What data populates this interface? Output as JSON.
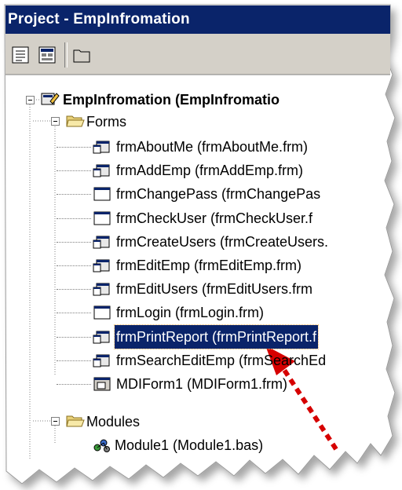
{
  "window": {
    "title": "Project - EmpInfromation"
  },
  "toolbar": {
    "buttons": [
      {
        "name": "view-code-button",
        "icon": "view-code-icon"
      },
      {
        "name": "view-object-button",
        "icon": "view-object-icon"
      },
      {
        "name": "toggle-folders-button",
        "icon": "folder-icon"
      }
    ]
  },
  "tree": {
    "project": {
      "label": "EmpInfromation (EmpInfromatio",
      "icon": "project-icon"
    },
    "forms_folder": {
      "label": "Forms",
      "icon": "folder-open-icon"
    },
    "forms": [
      {
        "label": "frmAboutMe (frmAboutMe.frm)",
        "icon": "form-icon"
      },
      {
        "label": "frmAddEmp (frmAddEmp.frm)",
        "icon": "form-icon"
      },
      {
        "label": "frmChangePass (frmChangePas",
        "icon": "form-window-icon"
      },
      {
        "label": "frmCheckUser (frmCheckUser.f",
        "icon": "form-window-icon"
      },
      {
        "label": "frmCreateUsers (frmCreateUsers.",
        "icon": "form-icon"
      },
      {
        "label": "frmEditEmp (frmEditEmp.frm)",
        "icon": "form-icon"
      },
      {
        "label": "frmEditUsers (frmEditUsers.frm",
        "icon": "form-icon"
      },
      {
        "label": "frmLogin (frmLogin.frm)",
        "icon": "form-window-icon"
      },
      {
        "label": "frmPrintReport (frmPrintReport.f",
        "icon": "form-icon",
        "selected": true
      },
      {
        "label": "frmSearchEditEmp (frmSearchEd",
        "icon": "form-icon"
      },
      {
        "label": "MDIForm1 (MDIForm1.frm)",
        "icon": "mdi-form-icon"
      }
    ],
    "modules_folder": {
      "label": "Modules",
      "icon": "folder-open-icon"
    },
    "modules": [
      {
        "label": "Module1 (Module1.bas)",
        "icon": "module-icon"
      }
    ]
  },
  "colors": {
    "title_bar": "#0a246a",
    "selection": "#0a246a",
    "panel": "#d4d0c8",
    "annotation_arrow": "#d60000"
  }
}
